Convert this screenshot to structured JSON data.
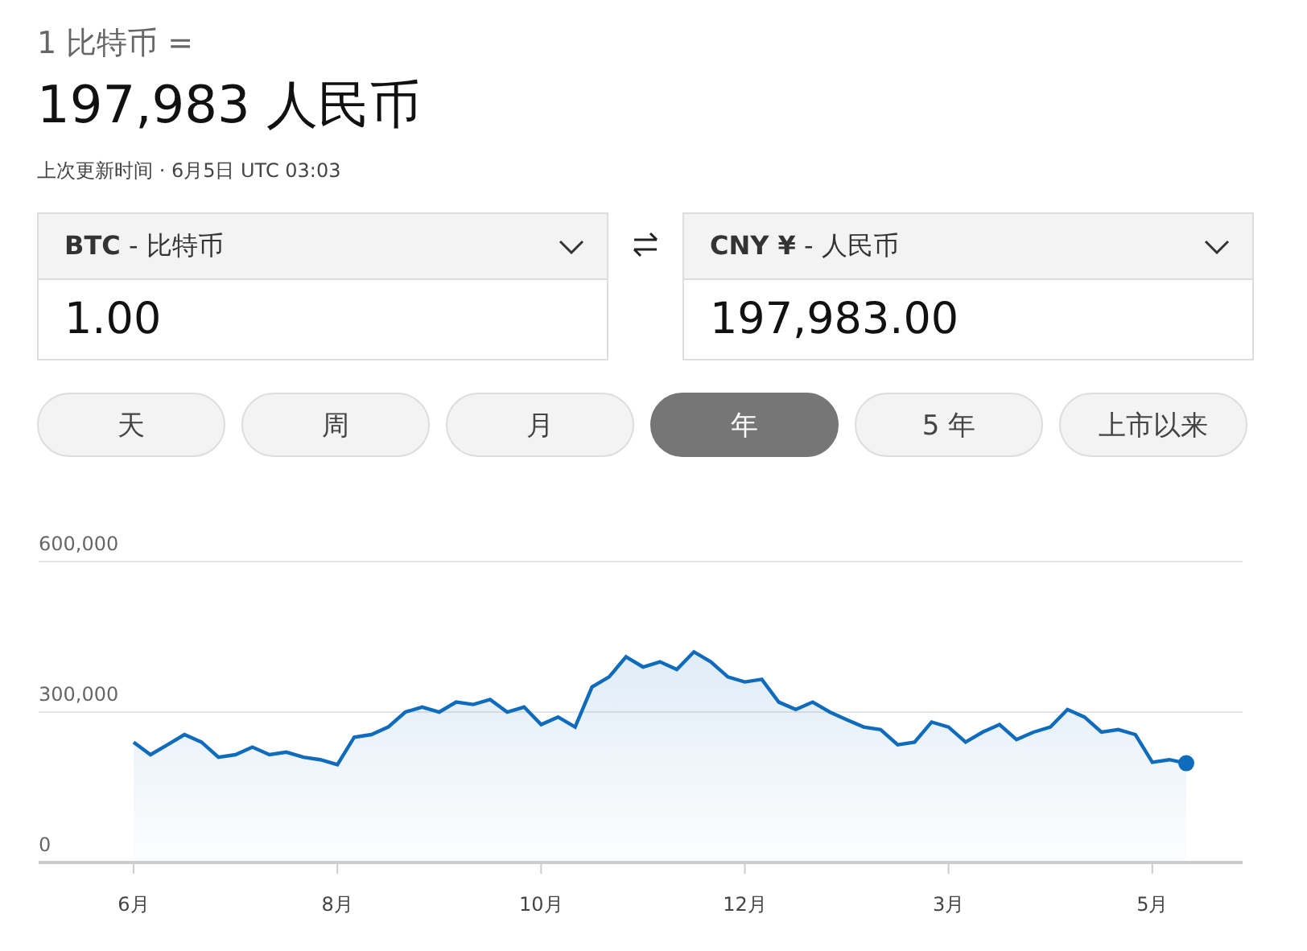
{
  "header": {
    "base": "1 比特币 =",
    "result": "197,983 人民币",
    "updated": "上次更新时间 · 6月5日 UTC 03:03"
  },
  "converter": [
    {
      "currency": "**BTC** - 比特币",
      "value": "1.00"
    },
    {
      "currency": "**CNY ¥** - 人民币",
      "value": "197,983.00"
    }
  ],
  "periods": [
    {
      "label": "天",
      "selected": false
    },
    {
      "label": "周",
      "selected": false
    },
    {
      "label": "月",
      "selected": false
    },
    {
      "label": "年",
      "selected": true
    },
    {
      "label": "5 年",
      "selected": false
    },
    {
      "label": "上市以来",
      "selected": false
    }
  ],
  "chart_data": {
    "type": "area",
    "ylim": [
      0,
      600000
    ],
    "yticks": [
      {
        "value": 0,
        "label": "0"
      },
      {
        "value": 300000,
        "label": "300,000"
      },
      {
        "value": 600000,
        "label": "600,000"
      }
    ],
    "categories": [
      "6月",
      null,
      null,
      null,
      null,
      null,
      null,
      null,
      null,
      null,
      null,
      null,
      "8月",
      null,
      null,
      null,
      null,
      null,
      null,
      null,
      null,
      null,
      null,
      null,
      "10月",
      null,
      null,
      null,
      null,
      null,
      null,
      null,
      null,
      null,
      null,
      null,
      "12月",
      null,
      null,
      null,
      null,
      null,
      null,
      null,
      null,
      null,
      null,
      null,
      "3月",
      null,
      null,
      null,
      null,
      null,
      null,
      null,
      null,
      null,
      null,
      null,
      "5月",
      null,
      null
    ],
    "series": [
      {
        "color": "#0f6cbd",
        "values": [
          240000,
          215000,
          235000,
          255000,
          240000,
          210000,
          215000,
          230000,
          215000,
          220000,
          210000,
          205000,
          195000,
          250000,
          255000,
          270000,
          300000,
          310000,
          300000,
          320000,
          315000,
          325000,
          300000,
          310000,
          275000,
          290000,
          270000,
          350000,
          370000,
          410000,
          390000,
          400000,
          385000,
          420000,
          400000,
          370000,
          360000,
          365000,
          320000,
          305000,
          320000,
          300000,
          285000,
          270000,
          265000,
          235000,
          240000,
          280000,
          270000,
          240000,
          260000,
          275000,
          245000,
          260000,
          270000,
          305000,
          290000,
          260000,
          265000,
          255000,
          200000,
          205000,
          198000
        ]
      }
    ]
  }
}
